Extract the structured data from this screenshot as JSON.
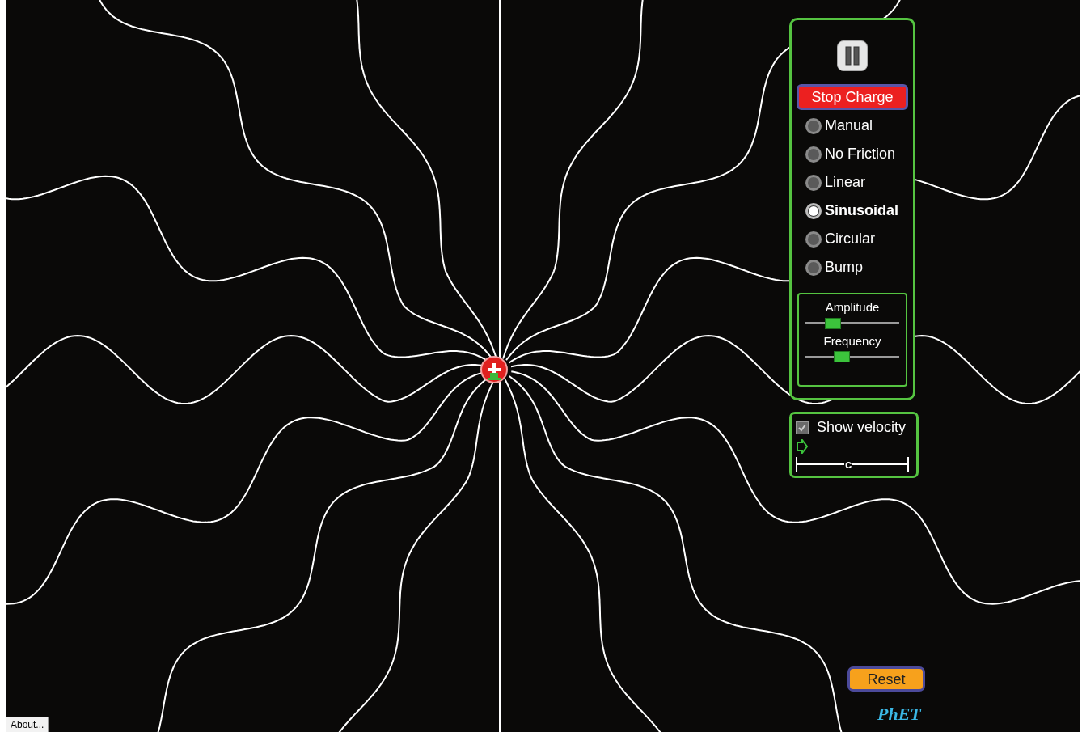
{
  "controls": {
    "pause_button": {
      "paused": false
    },
    "stop_button": {
      "label": "Stop Charge"
    },
    "motions": [
      {
        "label": "Manual",
        "selected": false
      },
      {
        "label": "No Friction",
        "selected": false
      },
      {
        "label": "Linear",
        "selected": false
      },
      {
        "label": "Sinusoidal",
        "selected": true
      },
      {
        "label": "Circular",
        "selected": false
      },
      {
        "label": "Bump",
        "selected": false
      }
    ],
    "sliders": [
      {
        "label": "Amplitude",
        "level": 0.29
      },
      {
        "label": "Frequency",
        "level": 0.39
      }
    ]
  },
  "velocity_panel": {
    "show_velocity": {
      "label": "Show velocity",
      "checked": true
    },
    "scale_label": "c"
  },
  "reset_button": {
    "label": "Reset"
  },
  "logo": "PhET",
  "about_button": {
    "label": "About..."
  }
}
